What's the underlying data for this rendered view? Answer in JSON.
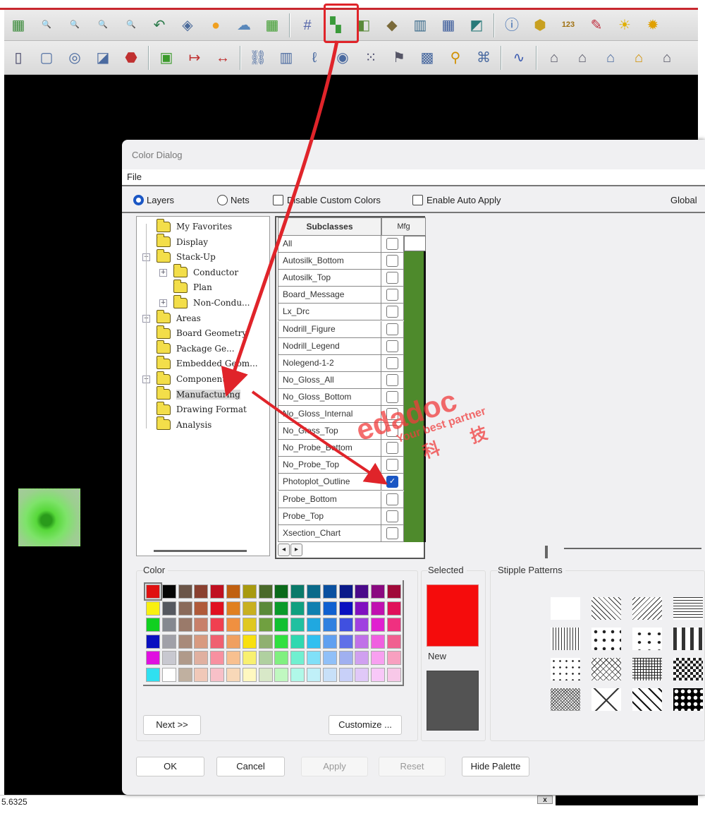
{
  "toolbar_row1": [
    {
      "name": "grid-view",
      "glyph": "▦",
      "color": "#3a8a3a"
    },
    {
      "name": "zoom-fit",
      "glyph": "🔍",
      "color": "#556"
    },
    {
      "name": "zoom-in-window",
      "glyph": "🔍",
      "color": "#a55"
    },
    {
      "name": "zoom-in",
      "glyph": "🔍",
      "color": "#a22"
    },
    {
      "name": "zoom-out",
      "glyph": "🔍",
      "color": "#a22"
    },
    {
      "name": "zoom-previous",
      "glyph": "↶",
      "color": "#2a7a4a"
    },
    {
      "name": "zoom-world",
      "glyph": "◈",
      "color": "#4a6a9a"
    },
    {
      "name": "unrats",
      "glyph": "●",
      "color": "#f0a020"
    },
    {
      "name": "shadow",
      "glyph": "☁",
      "color": "#5a88bb"
    },
    {
      "name": "film",
      "glyph": "▦",
      "color": "#3a9a2a"
    },
    {
      "sep": true
    },
    {
      "name": "grid-toggle",
      "glyph": "#",
      "color": "#5566aa"
    },
    {
      "name": "color-dialog",
      "glyph": "▚",
      "color": "#3a9a3a",
      "highlight": true
    },
    {
      "name": "color-layer",
      "glyph": "◧",
      "color": "#5a8a3a"
    },
    {
      "name": "shadow-mode",
      "glyph": "◆",
      "color": "#7a6a3a"
    },
    {
      "name": "spreadsheet-a",
      "glyph": "▥",
      "color": "#3a6a8a"
    },
    {
      "name": "spreadsheet-b",
      "glyph": "▦",
      "color": "#3a5a9a"
    },
    {
      "name": "3d-view",
      "glyph": "◩",
      "color": "#2a7a7a"
    },
    {
      "sep": true
    },
    {
      "name": "info",
      "glyph": "ⓘ",
      "color": "#3a6ab0"
    },
    {
      "name": "show-element",
      "glyph": "⬢",
      "color": "#c8a020"
    },
    {
      "name": "measure",
      "glyph": "123",
      "color": "#a07010"
    },
    {
      "name": "brush",
      "glyph": "✎",
      "color": "#c03040"
    },
    {
      "name": "highlight",
      "glyph": "☀",
      "color": "#e0b000"
    },
    {
      "name": "dehighlight",
      "glyph": "✹",
      "color": "#e0a000"
    }
  ],
  "toolbar_row2": [
    {
      "name": "edit-a",
      "glyph": "▯",
      "color": "#446"
    },
    {
      "name": "shape-rect",
      "glyph": "▢",
      "color": "#4a6aa0"
    },
    {
      "name": "shape-circle",
      "glyph": "◎",
      "color": "#4a6aa0"
    },
    {
      "name": "shape-fill",
      "glyph": "◪",
      "color": "#4a6aa0"
    },
    {
      "name": "place-pin",
      "glyph": "⬣",
      "color": "#c03030"
    },
    {
      "sep": true
    },
    {
      "name": "camera",
      "glyph": "▣",
      "color": "#3a9a2a"
    },
    {
      "name": "dim-edit",
      "glyph": "↦",
      "color": "#c03030"
    },
    {
      "name": "dim-linear",
      "glyph": "↔",
      "color": "#c03030"
    },
    {
      "sep": true
    },
    {
      "name": "pin-edit",
      "glyph": "⛓",
      "color": "#4a6aa0"
    },
    {
      "name": "book",
      "glyph": "▥",
      "color": "#4a6aa0"
    },
    {
      "name": "probe",
      "glyph": "ℓ",
      "color": "#4a6aa0"
    },
    {
      "name": "camera-snap",
      "glyph": "◉",
      "color": "#4a6aa0"
    },
    {
      "name": "dotted-select",
      "glyph": "⁙",
      "color": "#446"
    },
    {
      "name": "flag",
      "glyph": "⚑",
      "color": "#556"
    },
    {
      "name": "matrix",
      "glyph": "▩",
      "color": "#4a6aa0"
    },
    {
      "name": "spray",
      "glyph": "⚲",
      "color": "#d09000"
    },
    {
      "name": "net-graph",
      "glyph": "⌘",
      "color": "#4a6aa0"
    },
    {
      "sep": true
    },
    {
      "name": "wave",
      "glyph": "∿",
      "color": "#3a5ab0"
    },
    {
      "sep": true
    },
    {
      "name": "module-a",
      "glyph": "⌂",
      "color": "#556"
    },
    {
      "name": "module-b",
      "glyph": "⌂",
      "color": "#556"
    },
    {
      "name": "module-c",
      "glyph": "⌂",
      "color": "#4a6aa0"
    },
    {
      "name": "module-d",
      "glyph": "⌂",
      "color": "#d09000"
    },
    {
      "name": "module-e",
      "glyph": "⌂",
      "color": "#556"
    }
  ],
  "status": {
    "coordinate": "5.6325",
    "x_label": "x"
  },
  "dialog": {
    "title": "Color Dialog",
    "menu_file": "File",
    "radio_layers": "Layers",
    "radio_nets": "Nets",
    "disable_custom_colors": "Disable Custom Colors",
    "enable_auto_apply": "Enable Auto Apply",
    "global": "Global",
    "tree": [
      {
        "label": "My Favorites",
        "level": 0,
        "expander": ""
      },
      {
        "label": "Display",
        "level": 0,
        "expander": ""
      },
      {
        "label": "Stack-Up",
        "level": 0,
        "expander": "−",
        "open": true
      },
      {
        "label": "Conductor",
        "level": 1,
        "expander": "+"
      },
      {
        "label": "Plan",
        "level": 1,
        "expander": ""
      },
      {
        "label": "Non-Condu...",
        "level": 1,
        "expander": "+"
      },
      {
        "label": "Areas",
        "level": 0,
        "expander": "+"
      },
      {
        "label": "Board Geometry",
        "level": 0,
        "expander": ""
      },
      {
        "label": "Package Ge...",
        "level": 0,
        "expander": ""
      },
      {
        "label": "Embedded Geom...",
        "level": 0,
        "expander": ""
      },
      {
        "label": "Components",
        "level": 0,
        "expander": "+"
      },
      {
        "label": "Manufacturing",
        "level": 0,
        "expander": "",
        "selected": true
      },
      {
        "label": "Drawing Format",
        "level": 0,
        "expander": ""
      },
      {
        "label": "Analysis",
        "level": 0,
        "expander": ""
      }
    ],
    "grid_header_subclass": "Subclasses",
    "grid_header_layer": "Mfg",
    "subclasses": [
      {
        "label": "All",
        "checked": false
      },
      {
        "label": "Autosilk_Bottom",
        "checked": false
      },
      {
        "label": "Autosilk_Top",
        "checked": false
      },
      {
        "label": "Board_Message",
        "checked": false
      },
      {
        "label": "Lx_Drc",
        "checked": false
      },
      {
        "label": "Nodrill_Figure",
        "checked": false
      },
      {
        "label": "Nodrill_Legend",
        "checked": false
      },
      {
        "label": "Nolegend-1-2",
        "checked": false
      },
      {
        "label": "No_Gloss_All",
        "checked": false
      },
      {
        "label": "No_Gloss_Bottom",
        "checked": false
      },
      {
        "label": "No_Gloss_Internal",
        "checked": false
      },
      {
        "label": "No_Gloss_Top",
        "checked": false
      },
      {
        "label": "No_Probe_Bottom",
        "checked": false
      },
      {
        "label": "No_Probe_Top",
        "checked": false
      },
      {
        "label": "Photoplot_Outline",
        "checked": true
      },
      {
        "label": "Probe_Bottom",
        "checked": false
      },
      {
        "label": "Probe_Top",
        "checked": false
      },
      {
        "label": "Xsection_Chart",
        "checked": false
      }
    ],
    "layer_color": "#4e8a2c",
    "color_group_label": "Color",
    "palette": [
      [
        "#e01010",
        "#050505",
        "#6b5548",
        "#8a4030",
        "#c01020",
        "#c06010",
        "#a89a10",
        "#4a6a2a",
        "#0a6a1a",
        "#0a7a6a",
        "#0a6a8a",
        "#0a50a0",
        "#0a1a8a",
        "#4a0a8a",
        "#8a0a80",
        "#a00a3a"
      ],
      [
        "#f8f010",
        "#555860",
        "#8a6a5a",
        "#b05a3a",
        "#e01020",
        "#e08020",
        "#c8b020",
        "#5a8a3a",
        "#0a9a2a",
        "#10a080",
        "#1080b0",
        "#1060d0",
        "#0a10c0",
        "#8010c0",
        "#c010b0",
        "#e0105a"
      ],
      [
        "#10d020",
        "#858890",
        "#9a7a6a",
        "#c8806a",
        "#f04050",
        "#f09040",
        "#e0c820",
        "#70a040",
        "#10c030",
        "#20c0a0",
        "#20a8e0",
        "#3080e0",
        "#4050e0",
        "#a040e0",
        "#e020d0",
        "#f03080"
      ],
      [
        "#0a10c0",
        "#a0a0a8",
        "#a88a7a",
        "#d89a80",
        "#f06070",
        "#f0a060",
        "#f8e010",
        "#90b070",
        "#30e040",
        "#30d8b0",
        "#30c0f0",
        "#60a0f0",
        "#6070e8",
        "#c070e8",
        "#f060e0",
        "#f06090"
      ],
      [
        "#e010e0",
        "#c8c8d0",
        "#b09a8a",
        "#e0b0a0",
        "#f890a0",
        "#f8c090",
        "#f8f070",
        "#b0d0a0",
        "#80f080",
        "#70f0d0",
        "#80e0f8",
        "#90c0f8",
        "#a0b0f0",
        "#d0a0f0",
        "#f8a0f0",
        "#f8a0c0"
      ],
      [
        "#30e0f0",
        "#ffffff",
        "#c0b0a0",
        "#f0c8b8",
        "#f8c0c8",
        "#f8d8b8",
        "#fff8c0",
        "#d8e8c8",
        "#c0f8c0",
        "#b0f8e8",
        "#c0f0f8",
        "#c8e0f8",
        "#c8d0f8",
        "#e0c8f8",
        "#f8c8f8",
        "#f8c8e8"
      ]
    ],
    "next_button": "Next >>",
    "customize_button": "Customize ...",
    "selected_label": "Selected",
    "selected_color": "#f50c0c",
    "new_label": "New",
    "new_color": "#535353",
    "stipple_label": "Stipple Patterns",
    "stipples": [
      "solid-white",
      "diag-back",
      "diag-fwd",
      "horizontal",
      "vertical",
      "dots-a",
      "dots-b",
      "dashes",
      "dots-c",
      "crosshatch-diag",
      "grid",
      "checker",
      "dense-hatch",
      "diamond",
      "wave-cross",
      "dots-big"
    ],
    "buttons": {
      "ok": "OK",
      "cancel": "Cancel",
      "apply": "Apply",
      "reset": "Reset",
      "hide_palette": "Hide Palette"
    }
  },
  "watermark": {
    "brand": "edadoc",
    "tagline": "Your best partner",
    "cn": "科 技"
  }
}
